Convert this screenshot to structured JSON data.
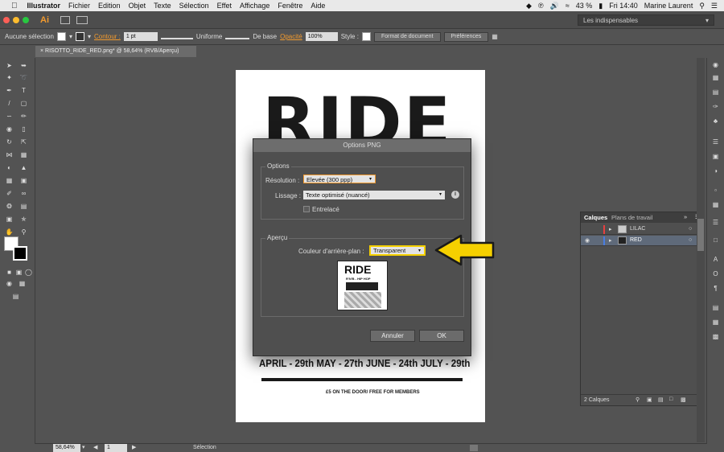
{
  "menubar": {
    "app_name": "Illustrator",
    "items": [
      "Fichier",
      "Edition",
      "Objet",
      "Texte",
      "Sélection",
      "Effet",
      "Affichage",
      "Fenêtre",
      "Aide"
    ],
    "battery": "43 %",
    "clock": "Fri 14:40",
    "user": "Marine Laurent"
  },
  "appbar": {
    "app_badge": "Ai",
    "workspace": "Les indispensables"
  },
  "control_bar": {
    "selection_label": "Aucune sélection",
    "stroke_label": "Contour :",
    "stroke_weight": "1 pt",
    "profile_uniform": "Uniforme",
    "brush_basic": "De base",
    "opacity_label": "Opacité",
    "opacity_value": "100%",
    "style_label": "Style :",
    "doc_format_button": "Format de document",
    "preferences_button": "Préférences"
  },
  "document_tab": {
    "title": "RISOTTO_RIDE_RED.png* @ 58,64% (RVB/Aperçu)"
  },
  "artboard": {
    "headline": "RIDE",
    "dates": "APRIL - 29th   MAY - 27th   JUNE - 24th   JULY - 29th",
    "footer": "£5 ON THE DOOR/ FREE FOR MEMBERS"
  },
  "dialog": {
    "title": "Options PNG",
    "options_group": "Options",
    "resolution_label": "Résolution :",
    "resolution_value": "Elevée (300 ppp)",
    "smoothing_label": "Lissage :",
    "smoothing_value": "Texte optimisé (nuancé)",
    "interlaced_label": "Entrelacé",
    "preview_group": "Aperçu",
    "background_label": "Couleur d'arrière-plan :",
    "background_value": "Transparent",
    "preview_headline": "RIDE",
    "preview_sub": "R'N'B - HIP HOP",
    "cancel_button": "Annuler",
    "ok_button": "OK"
  },
  "layers_panel": {
    "tab_layers": "Calques",
    "tab_artboards": "Plans de travail",
    "layers": [
      {
        "name": "LILAC",
        "color": "#e84040"
      },
      {
        "name": "RED",
        "color": "#4a7de0"
      }
    ],
    "footer_count": "2 Calques"
  },
  "status_bar": {
    "zoom": "58,64%",
    "page": "1",
    "tool": "Sélection"
  },
  "colors": {
    "accent_orange": "#f29a2e",
    "highlight_yellow": "#f5d000",
    "dialog_bg": "#4f4f4f",
    "panel_bg": "#535353"
  }
}
